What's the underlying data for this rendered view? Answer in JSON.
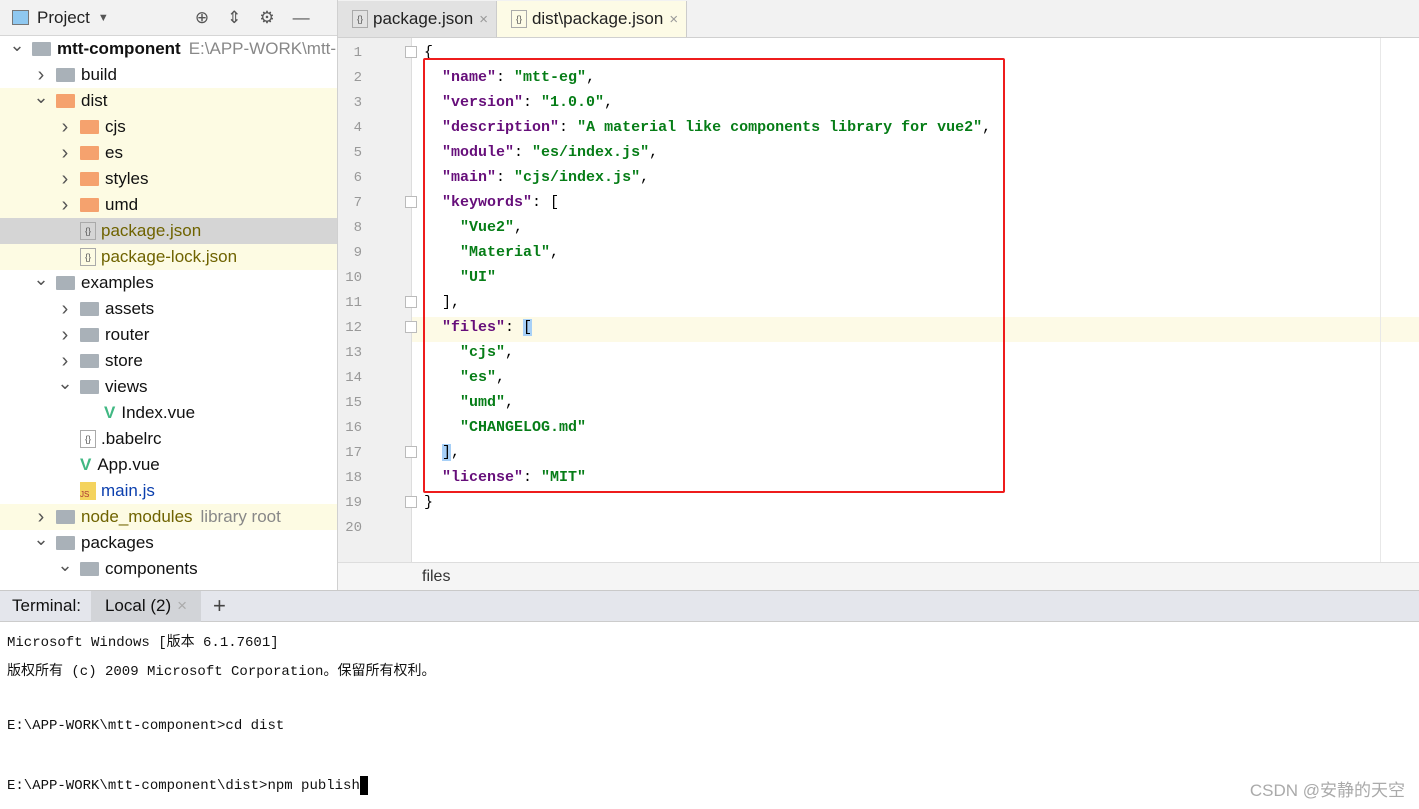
{
  "project_panel": {
    "title": "Project",
    "icons": [
      "target-icon",
      "collapse-icon",
      "gear-icon",
      "minimize-icon"
    ],
    "tree": [
      {
        "label": "mtt-component",
        "hint": "E:\\APP-WORK\\mtt-",
        "depth": 0,
        "type": "folder",
        "expanded": true,
        "bold": true
      },
      {
        "label": "build",
        "depth": 1,
        "type": "folder",
        "expanded": false
      },
      {
        "label": "dist",
        "depth": 1,
        "type": "folder-orange",
        "expanded": true,
        "hl": true
      },
      {
        "label": "cjs",
        "depth": 2,
        "type": "folder-orange",
        "expanded": false,
        "hl": true
      },
      {
        "label": "es",
        "depth": 2,
        "type": "folder-orange",
        "expanded": false,
        "hl": true
      },
      {
        "label": "styles",
        "depth": 2,
        "type": "folder-orange",
        "expanded": false,
        "hl": true
      },
      {
        "label": "umd",
        "depth": 2,
        "type": "folder-orange",
        "expanded": false,
        "hl": true
      },
      {
        "label": "package.json",
        "depth": 2,
        "type": "json",
        "sel": true,
        "color": "orange"
      },
      {
        "label": "package-lock.json",
        "depth": 2,
        "type": "json",
        "hl": true,
        "color": "orange"
      },
      {
        "label": "examples",
        "depth": 1,
        "type": "folder",
        "expanded": true
      },
      {
        "label": "assets",
        "depth": 2,
        "type": "folder",
        "expanded": false
      },
      {
        "label": "router",
        "depth": 2,
        "type": "folder",
        "expanded": false
      },
      {
        "label": "store",
        "depth": 2,
        "type": "folder",
        "expanded": false
      },
      {
        "label": "views",
        "depth": 2,
        "type": "folder",
        "expanded": true
      },
      {
        "label": "Index.vue",
        "depth": 3,
        "type": "vue"
      },
      {
        "label": ".babelrc",
        "depth": 2,
        "type": "json"
      },
      {
        "label": "App.vue",
        "depth": 2,
        "type": "vue"
      },
      {
        "label": "main.js",
        "depth": 2,
        "type": "js",
        "color": "blue"
      },
      {
        "label": "node_modules",
        "hint": "library root",
        "depth": 1,
        "type": "folder",
        "expanded": false,
        "hl": true,
        "color": "orange"
      },
      {
        "label": "packages",
        "depth": 1,
        "type": "folder",
        "expanded": true
      },
      {
        "label": "components",
        "depth": 2,
        "type": "folder",
        "expanded": true
      }
    ]
  },
  "editor": {
    "tabs": [
      {
        "label": "package.json",
        "active": false
      },
      {
        "label": "dist\\package.json",
        "active": true
      }
    ],
    "lines": [
      [
        [
          "p",
          "{"
        ]
      ],
      [
        [
          "p",
          "  "
        ],
        [
          "k",
          "\"name\""
        ],
        [
          "p",
          ": "
        ],
        [
          "s",
          "\"mtt-eg\""
        ],
        [
          "p",
          ","
        ]
      ],
      [
        [
          "p",
          "  "
        ],
        [
          "k",
          "\"version\""
        ],
        [
          "p",
          ": "
        ],
        [
          "s",
          "\"1.0.0\""
        ],
        [
          "p",
          ","
        ]
      ],
      [
        [
          "p",
          "  "
        ],
        [
          "k",
          "\"description\""
        ],
        [
          "p",
          ": "
        ],
        [
          "s",
          "\"A material like components library for vue2\""
        ],
        [
          "p",
          ","
        ]
      ],
      [
        [
          "p",
          "  "
        ],
        [
          "k",
          "\"module\""
        ],
        [
          "p",
          ": "
        ],
        [
          "s",
          "\"es/index.js\""
        ],
        [
          "p",
          ","
        ]
      ],
      [
        [
          "p",
          "  "
        ],
        [
          "k",
          "\"main\""
        ],
        [
          "p",
          ": "
        ],
        [
          "s",
          "\"cjs/index.js\""
        ],
        [
          "p",
          ","
        ]
      ],
      [
        [
          "p",
          "  "
        ],
        [
          "k",
          "\"keywords\""
        ],
        [
          "p",
          ": ["
        ]
      ],
      [
        [
          "p",
          "    "
        ],
        [
          "s",
          "\"Vue2\""
        ],
        [
          "p",
          ","
        ]
      ],
      [
        [
          "p",
          "    "
        ],
        [
          "s",
          "\"Material\""
        ],
        [
          "p",
          ","
        ]
      ],
      [
        [
          "p",
          "    "
        ],
        [
          "s",
          "\"UI\""
        ]
      ],
      [
        [
          "p",
          "  ],"
        ]
      ],
      [
        [
          "p",
          "  "
        ],
        [
          "k",
          "\"files\""
        ],
        [
          "p",
          ": "
        ],
        [
          "br",
          "["
        ]
      ],
      [
        [
          "p",
          "    "
        ],
        [
          "s",
          "\"cjs\""
        ],
        [
          "p",
          ","
        ]
      ],
      [
        [
          "p",
          "    "
        ],
        [
          "s",
          "\"es\""
        ],
        [
          "p",
          ","
        ]
      ],
      [
        [
          "p",
          "    "
        ],
        [
          "s",
          "\"umd\""
        ],
        [
          "p",
          ","
        ]
      ],
      [
        [
          "p",
          "    "
        ],
        [
          "s",
          "\"CHANGELOG.md\""
        ]
      ],
      [
        [
          "p",
          "  "
        ],
        [
          "br",
          "]"
        ],
        [
          "p",
          ","
        ]
      ],
      [
        [
          "p",
          "  "
        ],
        [
          "k",
          "\"license\""
        ],
        [
          "p",
          ": "
        ],
        [
          "s",
          "\"MIT\""
        ]
      ],
      [
        [
          "p",
          "}"
        ]
      ],
      [
        [
          "p",
          ""
        ]
      ]
    ],
    "current_line": 12,
    "breadcrumb": "files",
    "highlight_color": "#ee1c1c"
  },
  "terminal": {
    "label": "Terminal:",
    "tab": "Local (2)",
    "add": "+",
    "lines": [
      "Microsoft Windows [版本 6.1.7601]",
      "版权所有 (c) 2009 Microsoft Corporation。保留所有权利。",
      "",
      "E:\\APP-WORK\\mtt-component>cd dist",
      "",
      "E:\\APP-WORK\\mtt-component\\dist>npm publish"
    ]
  },
  "watermark": "CSDN @安静的天空"
}
